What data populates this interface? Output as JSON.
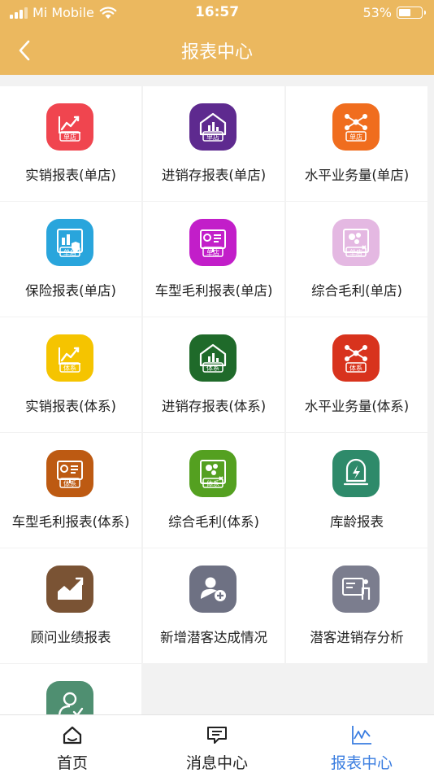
{
  "status_bar": {
    "carrier": "Mi Mobile",
    "time": "16:57",
    "battery": "53%",
    "battery_level": 0.53
  },
  "header": {
    "title": "报表中心"
  },
  "reports": [
    {
      "label": "实销报表(单店)",
      "badge": "单店",
      "color": "#f0454f",
      "icon": "sales-report-icon"
    },
    {
      "label": "进销存报表(单店)",
      "badge": "单店",
      "color": "#5e2a8f",
      "icon": "inventory-report-icon"
    },
    {
      "label": "水平业务量(单店)",
      "badge": "单店",
      "color": "#f06d1e",
      "icon": "business-volume-icon"
    },
    {
      "label": "保险报表(单店)",
      "badge": "单店",
      "color": "#29a5dc",
      "icon": "insurance-report-icon"
    },
    {
      "label": "车型毛利报表(单店)",
      "badge": "单店",
      "color": "#c21ec9",
      "icon": "model-profit-icon"
    },
    {
      "label": "综合毛利(单店)",
      "badge": "单店",
      "color": "#e4b8e2",
      "icon": "overall-profit-icon"
    },
    {
      "label": "实销报表(体系)",
      "badge": "体系",
      "color": "#f5c400",
      "icon": "sales-report-icon"
    },
    {
      "label": "进销存报表(体系)",
      "badge": "体系",
      "color": "#1f6a2a",
      "icon": "inventory-report-icon"
    },
    {
      "label": "水平业务量(体系)",
      "badge": "体系",
      "color": "#d8331d",
      "icon": "business-volume-icon"
    },
    {
      "label": "车型毛利报表(体系)",
      "badge": "体系",
      "color": "#bd5a12",
      "icon": "model-profit-icon"
    },
    {
      "label": "综合毛利(体系)",
      "badge": "体系",
      "color": "#54a020",
      "icon": "overall-profit-icon"
    },
    {
      "label": "库龄报表",
      "badge": "",
      "color": "#2e8a6a",
      "icon": "stock-age-icon"
    },
    {
      "label": "顾问业绩报表",
      "badge": "",
      "color": "#7a5334",
      "icon": "consultant-performance-icon"
    },
    {
      "label": "新增潜客达成情况",
      "badge": "",
      "color": "#6e7183",
      "icon": "add-prospect-icon"
    },
    {
      "label": "潜客进销存分析",
      "badge": "",
      "color": "#7b7d8e",
      "icon": "prospect-analysis-icon"
    },
    {
      "label": "",
      "badge": "",
      "color": "#4f8f71",
      "icon": "prospect-check-icon"
    }
  ],
  "tabs": [
    {
      "label": "首页",
      "icon": "home-icon",
      "active": false
    },
    {
      "label": "消息中心",
      "icon": "message-icon",
      "active": false
    },
    {
      "label": "报表中心",
      "icon": "report-chart-icon",
      "active": true
    }
  ],
  "colors": {
    "header_bg": "#ebb85f",
    "active_tab": "#3a7de0"
  }
}
